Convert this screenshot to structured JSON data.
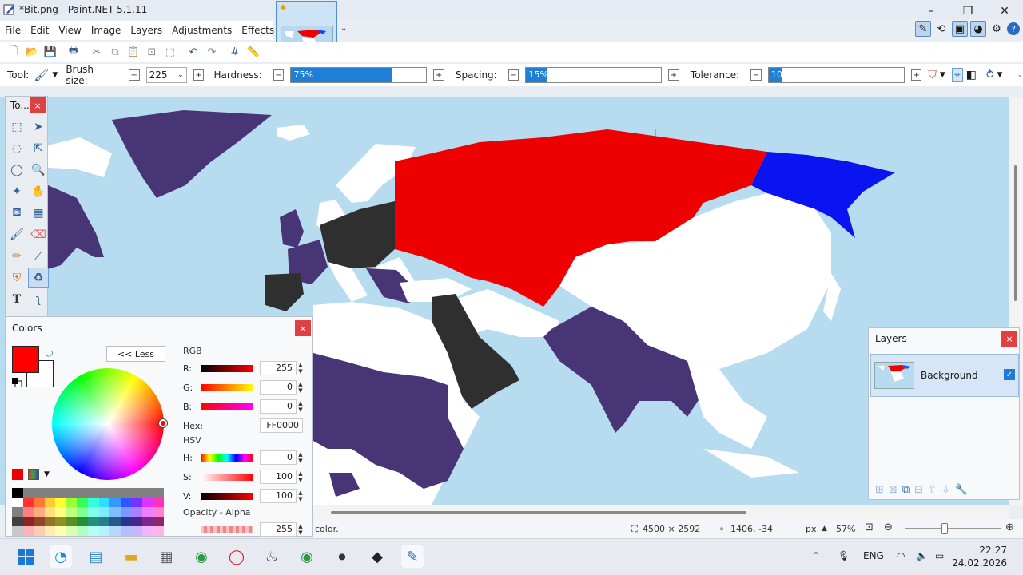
{
  "window": {
    "title": "*Bit.png - Paint.NET 5.1.11",
    "minimize": "–",
    "maximize": "❐",
    "close": "✕"
  },
  "menu": [
    "File",
    "Edit",
    "View",
    "Image",
    "Layers",
    "Adjustments",
    "Effects"
  ],
  "toolbar2": {
    "tool_label": "Tool:",
    "brush_size_label": "Brush size:",
    "brush_size_value": "225",
    "hardness_label": "Hardness:",
    "hardness_value": "75%",
    "hardness_fraction": 0.75,
    "spacing_label": "Spacing:",
    "spacing_value": "15%",
    "spacing_fraction": 0.15,
    "tolerance_label": "Tolerance:",
    "tolerance_value": "10%",
    "tolerance_fraction": 0.1
  },
  "tools_panel": {
    "title": "To...",
    "close": "×"
  },
  "colors_panel": {
    "title": "Colors",
    "close": "×",
    "less_button": "<< Less",
    "primary_color": "#FF0000",
    "secondary_color": "#FFFFFF",
    "rgb_label": "RGB",
    "r_label": "R:",
    "r_value": "255",
    "g_label": "G:",
    "g_value": "0",
    "b_label": "B:",
    "b_value": "0",
    "hex_label": "Hex:",
    "hex_value": "FF0000",
    "hsv_label": "HSV",
    "h_label": "H:",
    "h_value": "0",
    "s_label": "S:",
    "s_value": "100",
    "v_label": "V:",
    "v_value": "100",
    "opacity_label": "Opacity - Alpha",
    "opacity_value": "255"
  },
  "layers_panel": {
    "title": "Layers",
    "close": "×",
    "layer_name": "Background",
    "check": "✓"
  },
  "statusbar": {
    "hint": "color.",
    "image_size": "4500 × 2592",
    "cursor_pos": "1406, -34",
    "unit": "px",
    "zoom": "57%"
  },
  "taskbar": {
    "lang": "ENG",
    "time": "22:27",
    "date": "24.02.2026"
  },
  "colors": {
    "russia": "#ee0000",
    "blue_east": "#0a14f0",
    "purple": "#483575",
    "dark": "#2f2f2f",
    "land": "#ffffff",
    "sea": "#b8dcef",
    "accent": "#1d80d6"
  }
}
